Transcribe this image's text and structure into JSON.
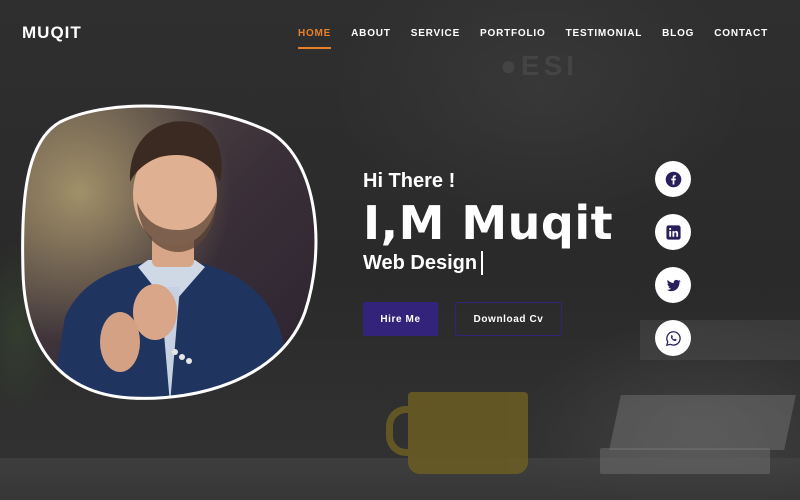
{
  "brand": {
    "logo": "MUQIT"
  },
  "nav": {
    "items": [
      {
        "label": "HOME",
        "active": true
      },
      {
        "label": "ABOUT"
      },
      {
        "label": "SERVICE"
      },
      {
        "label": "PORTFOLIO"
      },
      {
        "label": "TESTIMONIAL"
      },
      {
        "label": "BLOG"
      },
      {
        "label": "CONTACT"
      }
    ]
  },
  "hero": {
    "greeting": "Hi There !",
    "name": "I,M Muqit",
    "role": "Web Design",
    "buttons": {
      "hire": "Hire Me",
      "download": "Download Cv"
    }
  },
  "social": [
    {
      "icon": "facebook-icon"
    },
    {
      "icon": "linkedin-icon"
    },
    {
      "icon": "twitter-icon"
    },
    {
      "icon": "whatsapp-icon"
    }
  ],
  "colors": {
    "accent": "#e8802a",
    "primary_button": "#33237a",
    "icon_color": "#2a1f5a"
  }
}
